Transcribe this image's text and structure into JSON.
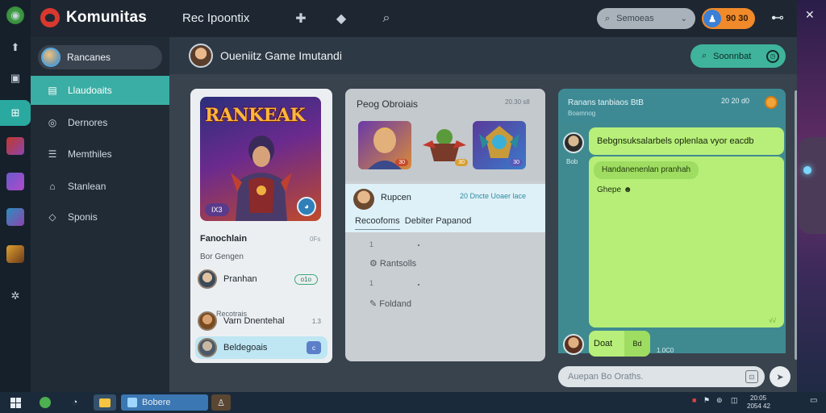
{
  "app": {
    "brand": "Komunitas",
    "window_title": "Rec Ipoontix"
  },
  "top": {
    "search_placeholder": "Semoeas",
    "badge_value": "90 30"
  },
  "sidebar": {
    "profile_name": "Rancanes",
    "items": [
      {
        "label": "Llaudoaits",
        "icon": "page-icon",
        "active": true
      },
      {
        "label": "Dernores",
        "icon": "globe-icon",
        "active": false
      },
      {
        "label": "Memthiles",
        "icon": "list-icon",
        "active": false
      },
      {
        "label": "Stanlean",
        "icon": "home-icon",
        "active": false
      },
      {
        "label": "Sponis",
        "icon": "shield-icon",
        "active": false
      }
    ]
  },
  "header": {
    "title": "Oueniitz Game Imutandi",
    "action_label": "Soonnbat"
  },
  "game_card": {
    "art_title": "RANKEAK",
    "art_tag": "IX3",
    "heading": "Fanochlain",
    "heading_meta": "0Fs",
    "subheading": "Bor Gengen",
    "rows": [
      {
        "name": "Pranhan",
        "end": "o1o",
        "style": "pill"
      },
      {
        "name": "Varn Dnentehal",
        "end": "1.3",
        "style": "plain"
      },
      {
        "name": "Beldegoais",
        "end": "c",
        "style": "chip",
        "highlight": true
      }
    ],
    "caption": "Recotrais"
  },
  "middle_card": {
    "title": "Peog Obroiais",
    "meta": "20.30 s8",
    "thumbs": [
      {
        "tag": "30"
      },
      {
        "tag": "30"
      },
      {
        "tag": "30"
      }
    ],
    "message": {
      "name": "Rupcen",
      "time": "20 Dncte Uoaer lace",
      "line_a": "Recoofoms",
      "line_b": "Debiter Papanod"
    },
    "list": [
      {
        "bullet": "1",
        "label": ""
      },
      {
        "bullet": "",
        "label": "Rantsolls"
      },
      {
        "bullet": "1",
        "label": ""
      },
      {
        "bullet": "",
        "label": "Foldand"
      }
    ]
  },
  "chat": {
    "header_title": "Ranans tanbiaos BtB",
    "header_sub": "Boamnog",
    "header_meta": "20 20 d0",
    "msg1": "Bebgnsuksalarbels oplenlaa vyor eacdb",
    "msg2_inner": "Handanenenlan pranhah",
    "msg2_sub": "Ghepe",
    "msg2_ticks": "√√",
    "msg3": "Doat",
    "msg3_end": "Bd",
    "time1": "Bob",
    "time2": "1.0C0",
    "input_placeholder": "Auepan Bo Oraths."
  },
  "taskbar": {
    "app_label": "Bobere",
    "clock_line1": "20:05",
    "clock_line2": "2054 42"
  }
}
